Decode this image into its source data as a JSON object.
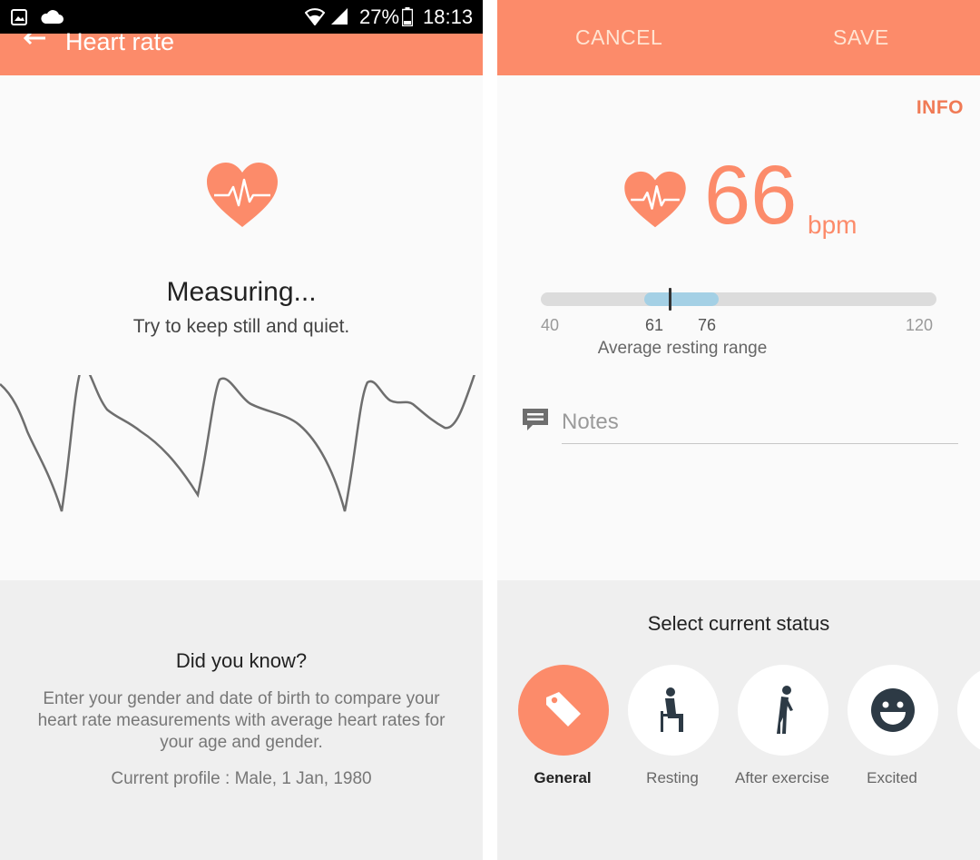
{
  "status_bar": {
    "battery": "27%",
    "time": "18:13",
    "icons": [
      "gallery-notification-icon",
      "cloud-icon",
      "wifi-icon",
      "signal-icon",
      "battery-icon"
    ]
  },
  "measure_screen": {
    "title": "Heart rate",
    "measuring_title": "Measuring...",
    "measuring_hint": "Try to keep still and quiet.",
    "did_you_know": {
      "title": "Did you know?",
      "body": "Enter your gender and date of birth to compare your heart rate measurements with average heart rates for your age and gender.",
      "profile": "Current profile : Male, 1 Jan, 1980"
    }
  },
  "result_screen": {
    "actions": {
      "cancel": "CANCEL",
      "save": "SAVE"
    },
    "info_link": "INFO",
    "bpm_value": "66",
    "bpm_unit": "bpm",
    "range": {
      "min": "40",
      "low": "61",
      "high": "76",
      "max": "120",
      "label": "Average resting range",
      "current": 66
    },
    "notes_placeholder": "Notes",
    "status": {
      "title": "Select current status",
      "options": [
        {
          "label": "General",
          "icon": "tag-icon",
          "selected": true
        },
        {
          "label": "Resting",
          "icon": "sitting-person-icon",
          "selected": false
        },
        {
          "label": "After exercise",
          "icon": "bent-over-person-icon",
          "selected": false
        },
        {
          "label": "Excited",
          "icon": "smiley-face-icon",
          "selected": false
        }
      ]
    }
  },
  "colors": {
    "accent": "#fc8b6a",
    "info_text": "#f07a55",
    "range_band": "#a4d0e5",
    "status_bar": "#000000"
  }
}
